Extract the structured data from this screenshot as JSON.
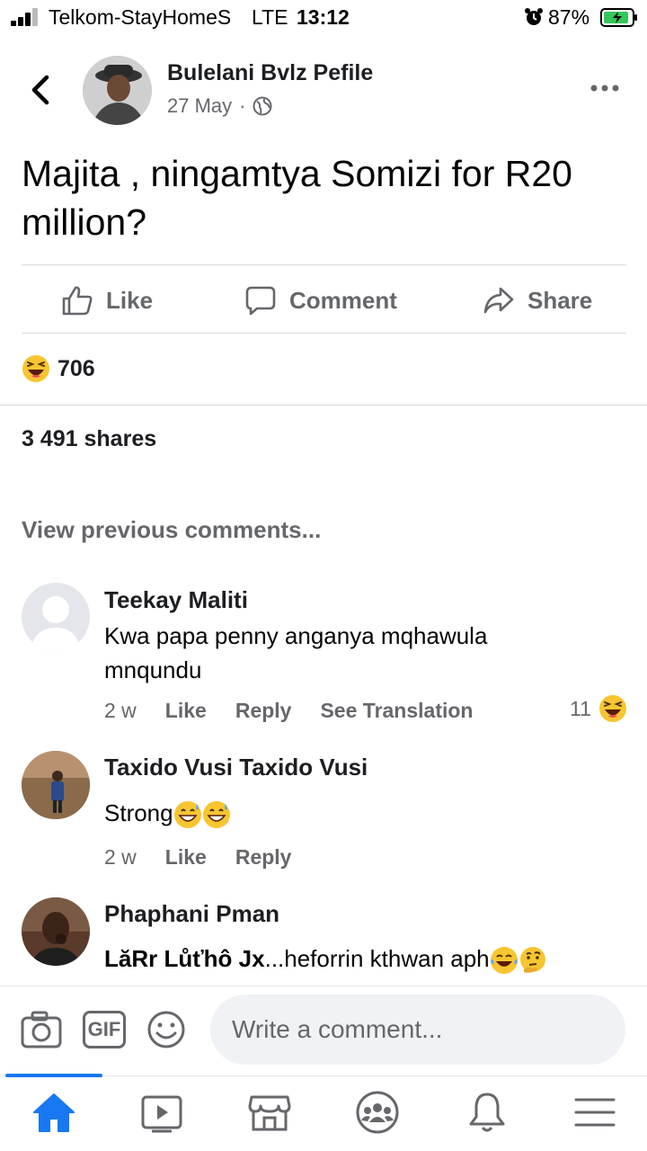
{
  "status_bar": {
    "carrier": "Telkom-StayHomeS",
    "network": "LTE",
    "time": "13:12",
    "battery": "87%"
  },
  "post": {
    "author": "Bulelani Bvlz Pefile",
    "date": "27 May",
    "separator": "·",
    "text": "Majita , ningamtya Somizi for R20 million?",
    "actions": {
      "like": "Like",
      "comment": "Comment",
      "share": "Share"
    },
    "reaction_count": "706",
    "shares": "3 491 shares"
  },
  "comments_section": {
    "view_previous": "View previous comments...",
    "comments": [
      {
        "name": "Teekay Maliti",
        "text": "Kwa papa penny anganya mqhawula mnqundu",
        "time": "2 w",
        "like": "Like",
        "reply": "Reply",
        "see_translation": "See Translation",
        "reactions": "11"
      },
      {
        "name": "Taxido Vusi Taxido Vusi",
        "text": "Strong",
        "time": "2 w",
        "like": "Like",
        "reply": "Reply"
      },
      {
        "name": "Phaphani Pman",
        "mention": "LăRr Lůťhô Jx",
        "text": "...heforrin kthwan aph"
      }
    ]
  },
  "composer": {
    "placeholder": "Write a comment...",
    "gif_label": "GIF"
  },
  "colors": {
    "accent": "#1877f2",
    "secondary_text": "#65676b",
    "divider": "#d9d9d9",
    "input_bg": "#f0f2f5"
  },
  "icons": [
    "signal-icon",
    "alarm-icon",
    "battery-icon",
    "back-icon",
    "globe-icon",
    "more-icon",
    "like-icon",
    "comment-icon",
    "share-icon",
    "laughing-emoji-icon",
    "camera-icon",
    "gif-icon",
    "emoji-icon",
    "home-icon",
    "watch-icon",
    "marketplace-icon",
    "groups-icon",
    "notifications-icon",
    "menu-icon"
  ]
}
